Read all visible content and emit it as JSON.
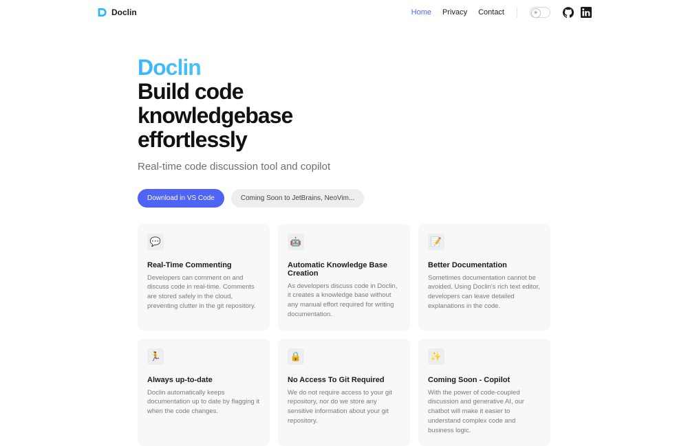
{
  "brand": "Doclin",
  "nav": {
    "links": [
      {
        "label": "Home",
        "active": true
      },
      {
        "label": "Privacy",
        "active": false
      },
      {
        "label": "Contact",
        "active": false
      }
    ]
  },
  "hero": {
    "brand": "Doclin",
    "title_line1": "Build code",
    "title_line2": "knowledgebase",
    "title_line3": "effortlessly",
    "subtitle": "Real-time code discussion tool and copilot",
    "primary_cta": "Download in VS Code",
    "secondary_cta": "Coming Soon to JetBrains, NeoVim..."
  },
  "features": [
    {
      "icon": "💬",
      "title": "Real-Time Commenting",
      "desc": "Developers can comment on and discuss code in real-time. Comments are stored safely in the cloud, preventing clutter in the git repository."
    },
    {
      "icon": "🤖",
      "title": "Automatic Knowledge Base Creation",
      "desc": "As developers discuss code in Doclin, it creates a knowledge base without any manual effort required for writing documentation."
    },
    {
      "icon": "📝",
      "title": "Better Documentation",
      "desc": "Sometimes documentation cannot be avoided. Using Doclin's rich text editor, developers can leave detailed explanations in the code."
    },
    {
      "icon": "🏃",
      "title": "Always up-to-date",
      "desc": "Doclin automatically keeps documentation up to date by flagging it when the code changes."
    },
    {
      "icon": "🔒",
      "title": "No Access To Git Required",
      "desc": "We do not require access to your git repository, nor do we store any sensitive information about your git repository."
    },
    {
      "icon": "✨",
      "title": "Coming Soon - Copilot",
      "desc": "With the power of code-coupled discussion and generative AI, our chatbot will make it easier to understand complex code and business logic."
    }
  ]
}
